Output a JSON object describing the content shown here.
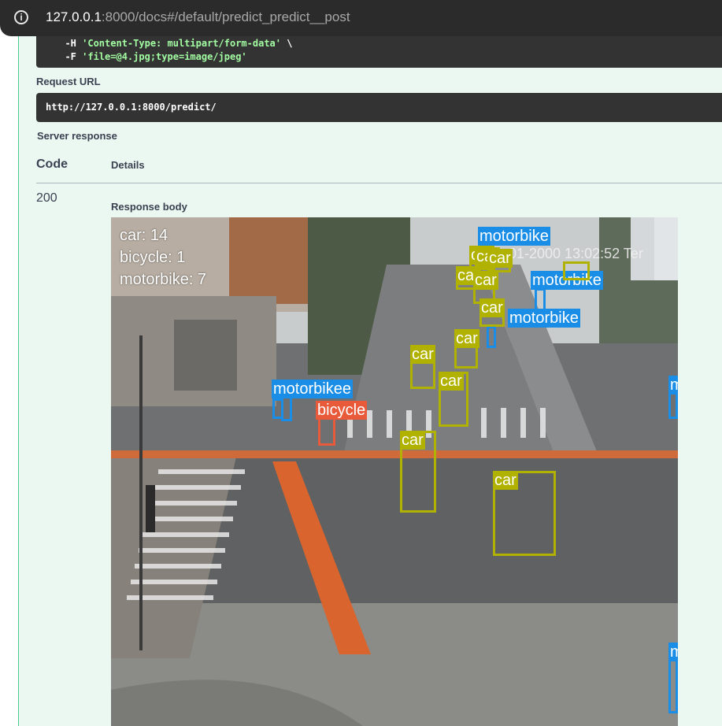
{
  "browser": {
    "url_host": "127.0.0.1",
    "url_rest": ":8000/docs#/default/predict_predict__post"
  },
  "curl": {
    "line1_flag": "  -H ",
    "line1_value": "'Content-Type: multipart/form-data'",
    "line1_tail": " \\",
    "line2_flag": "  -F ",
    "line2_value": "'file=@4.jpg;type=image/jpeg'"
  },
  "request_url": {
    "label": "Request URL",
    "value": "http://127.0.0.1:8000/predict/"
  },
  "server_response": {
    "label": "Server response",
    "col_code": "Code",
    "col_details": "Details",
    "status_code": "200",
    "body_label": "Response body"
  },
  "detection_image": {
    "counts": [
      "car: 14",
      "bicycle: 1",
      "motorbike: 7"
    ],
    "timestamp": "01-2000 13:02:52 Ter",
    "labels": {
      "car": "car",
      "motorbike": "motorbike",
      "motorbike_extra": "motorbikee",
      "bicycle": "bicycle",
      "motorbike_cut": "m"
    }
  },
  "colors": {
    "panel_bg": "#ebf8f1",
    "panel_border": "#49cc90",
    "code_bg": "#333333",
    "car_box": "#b1b100",
    "motorbike_box": "#1a8ee6",
    "bicycle_box": "#e85a3a"
  }
}
